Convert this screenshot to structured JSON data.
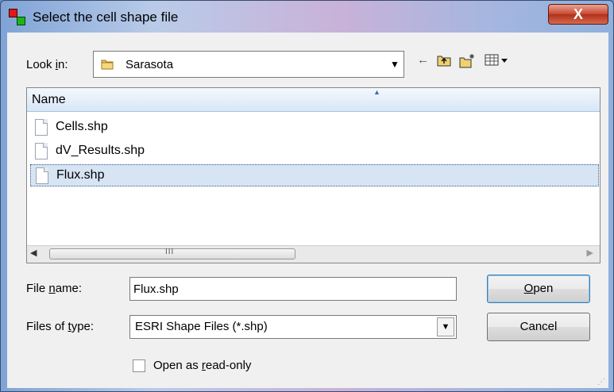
{
  "window": {
    "title": "Select the cell shape file",
    "close_label": "X"
  },
  "look_in": {
    "label_pre": "Look ",
    "label_key": "i",
    "label_post": "n:",
    "value": "Sarasota"
  },
  "toolbar": {
    "back": "←",
    "up": "⤴",
    "new_folder": "✱",
    "views": "▦▾"
  },
  "file_list": {
    "column_name": "Name",
    "files": [
      {
        "name": "Cells.shp",
        "selected": false
      },
      {
        "name": "dV_Results.shp",
        "selected": false
      },
      {
        "name": "Flux.shp",
        "selected": true
      }
    ],
    "scroll_grip": "III"
  },
  "file_name": {
    "label_pre": "File ",
    "label_key": "n",
    "label_post": "ame:",
    "value": "Flux.shp"
  },
  "file_type": {
    "label_pre": "Files of ",
    "label_key": "t",
    "label_post": "ype:",
    "value": "ESRI Shape Files (*.shp)"
  },
  "buttons": {
    "open_key": "O",
    "open_rest": "pen",
    "cancel": "Cancel"
  },
  "readonly": {
    "label_pre": "Open as ",
    "label_key": "r",
    "label_post": "ead-only",
    "checked": false
  }
}
